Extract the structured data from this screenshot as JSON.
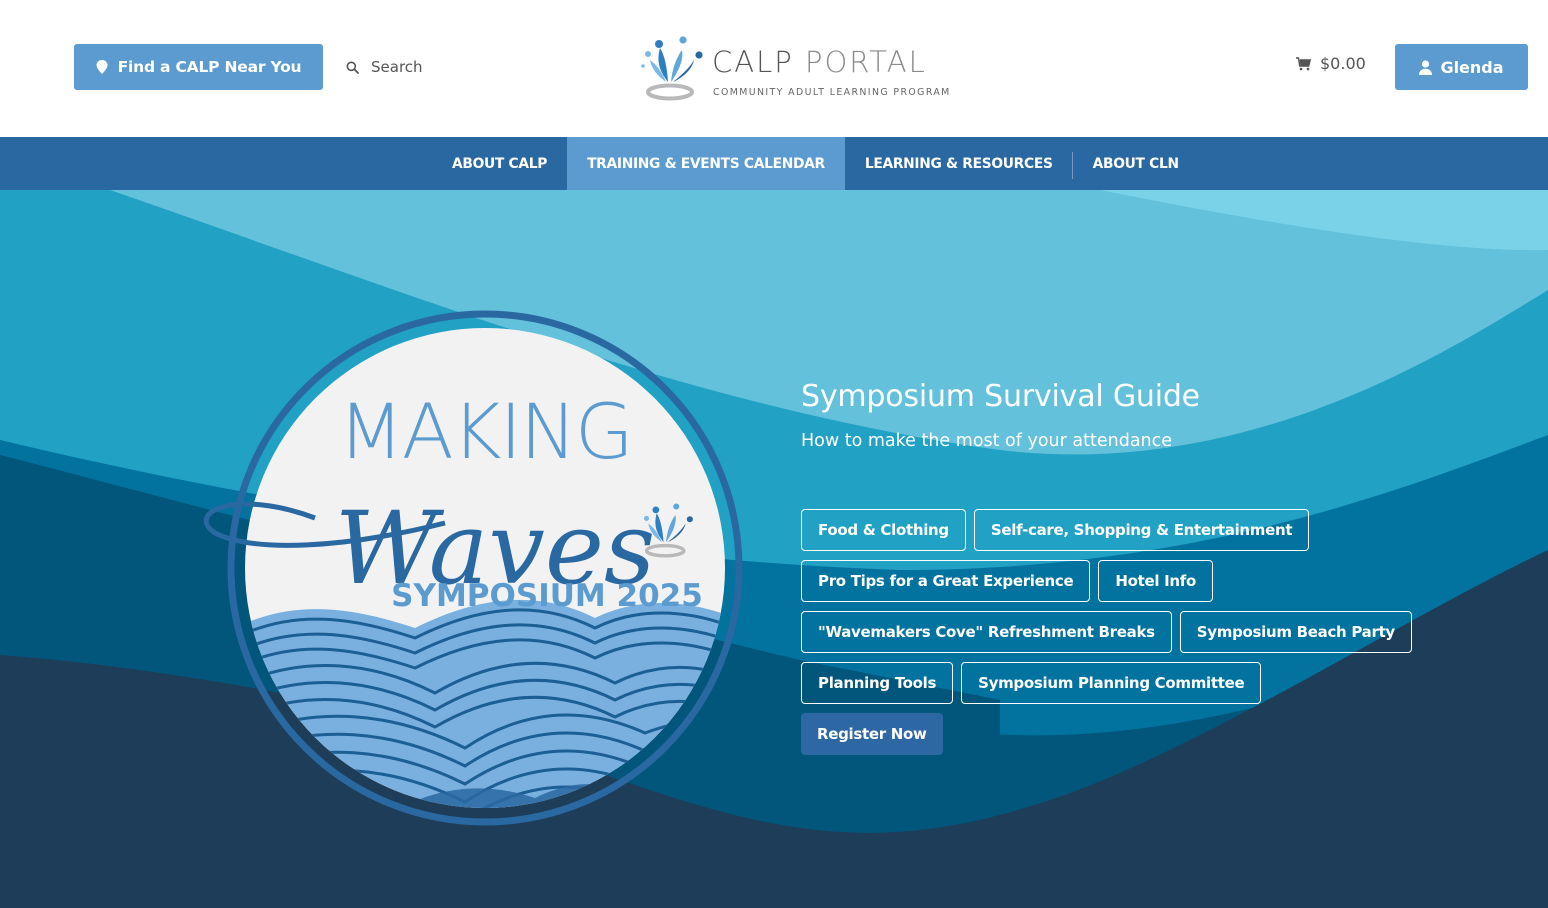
{
  "header": {
    "find_button": {
      "label": "Find a CALP Near You",
      "icon": "map-pin-icon"
    },
    "search": {
      "label": "Search",
      "icon": "search-icon"
    },
    "logo": {
      "title_part1": "CALP",
      "title_part2": "PORTAL",
      "subtitle": "COMMUNITY ADULT LEARNING PROGRAM",
      "icon": "fountain-people-icon"
    },
    "cart": {
      "amount": "$0.00",
      "icon": "cart-icon"
    },
    "user": {
      "name": "Glenda",
      "icon": "user-icon"
    }
  },
  "nav": {
    "items": [
      {
        "label": "ABOUT CALP",
        "active": false
      },
      {
        "label": "TRAINING & EVENTS CALENDAR",
        "active": true
      },
      {
        "label": "LEARNING & RESOURCES",
        "active": false
      },
      {
        "label": "ABOUT CLN",
        "active": false
      }
    ]
  },
  "hero": {
    "badge": {
      "line1": "MAKING",
      "line2": "Waves",
      "line3": "SYMPOSIUM 2025"
    },
    "title": "Symposium Survival Guide",
    "subtitle": "How to make the most of your attendance",
    "link_rows": [
      [
        "Food & Clothing",
        "Self-care, Shopping & Entertainment"
      ],
      [
        "Pro Tips for a Great Experience",
        "Hotel Info"
      ],
      [
        "\"Wavemakers Cove\" Refreshment Breaks",
        "Symposium Beach Party"
      ],
      [
        "Planning Tools",
        "Symposium Planning Committee"
      ]
    ],
    "register_label": "Register Now"
  },
  "colors": {
    "brand_blue": "#5b9bd0",
    "nav_blue": "#2a68a2",
    "wave_lightest": "#79d2e8",
    "wave_light": "#64c1db",
    "wave_mid": "#21a1c4",
    "wave_deep": "#02729e",
    "wave_deeper": "#02567b",
    "wave_darkest": "#1e3d58"
  }
}
